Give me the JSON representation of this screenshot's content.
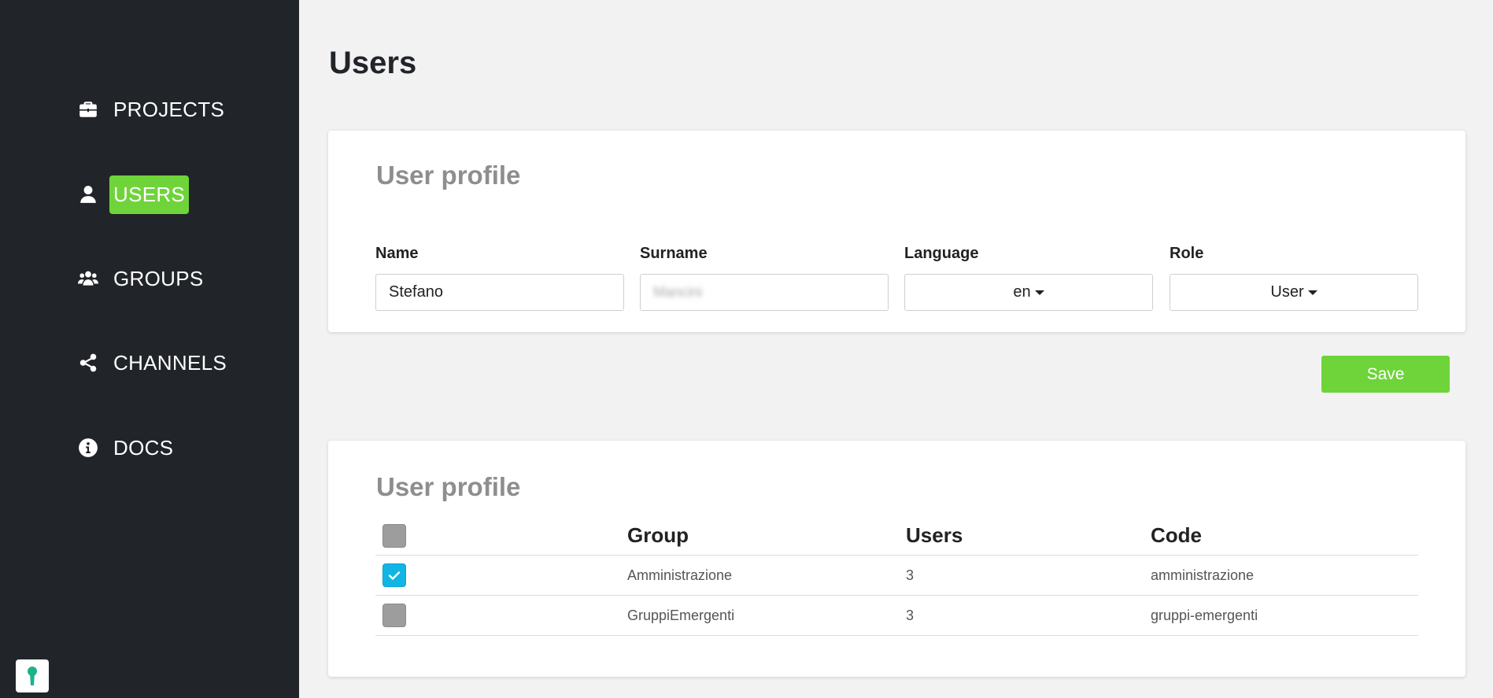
{
  "sidebar": {
    "items": [
      {
        "label": "PROJECTS",
        "icon": "briefcase-icon",
        "active": false
      },
      {
        "label": "USERS",
        "icon": "user-icon",
        "active": true
      },
      {
        "label": "GROUPS",
        "icon": "users-group-icon",
        "active": false
      },
      {
        "label": "CHANNELS",
        "icon": "share-icon",
        "active": false
      },
      {
        "label": "DOCS",
        "icon": "info-circle-icon",
        "active": false
      }
    ],
    "bottom_icon": "keyhole-icon"
  },
  "page": {
    "title": "Users"
  },
  "profile_card": {
    "title": "User profile",
    "name": {
      "label": "Name",
      "value": "Stefano"
    },
    "surname": {
      "label": "Surname",
      "value": "Mancini"
    },
    "language": {
      "label": "Language",
      "value": "en"
    },
    "role": {
      "label": "Role",
      "value": "User"
    }
  },
  "save_label": "Save",
  "groups_card": {
    "title": "User profile",
    "columns": [
      "Group",
      "Users",
      "Code"
    ],
    "rows": [
      {
        "group": "Amministrazione",
        "users": "3",
        "code": "amministrazione",
        "checked": true
      },
      {
        "group": "GruppiEmergenti",
        "users": "3",
        "code": "gruppi-emergenti",
        "checked": false
      }
    ]
  },
  "colors": {
    "sidebar_bg": "#212529",
    "accent_green": "#6fd43a",
    "checkbox_checked": "#11b5e4",
    "checkbox_unchecked": "#9d9d9d"
  }
}
